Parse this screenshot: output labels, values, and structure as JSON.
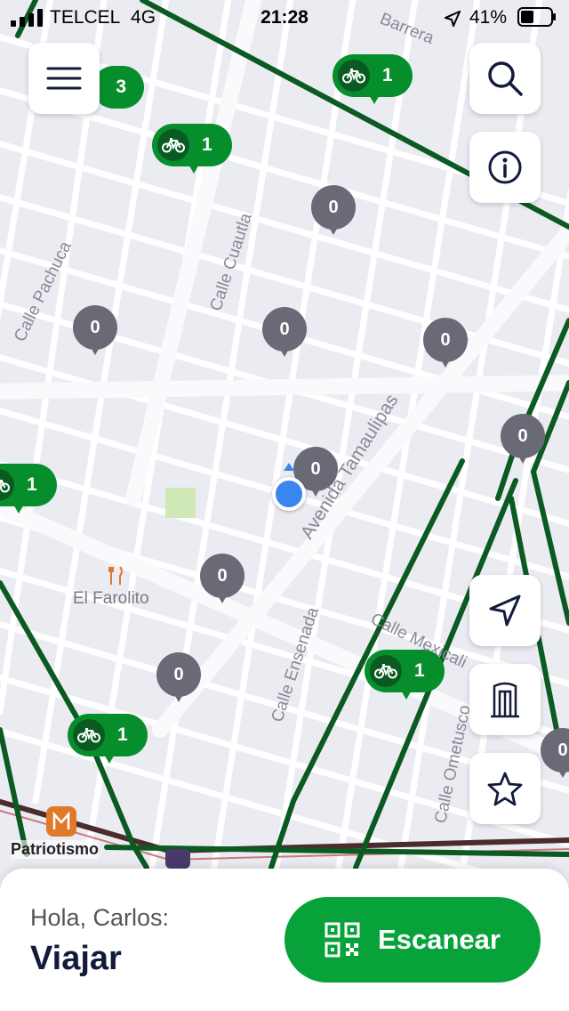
{
  "status_bar": {
    "carrier": "TELCEL",
    "network": "4G",
    "time": "21:28",
    "battery": "41%"
  },
  "map": {
    "streets": [
      "Calle Pachuca",
      "Calle Cuautla",
      "Avenida Tamaulipas",
      "Calle Ensenada",
      "Calle Mexicali",
      "Calle Ometusco",
      "Barrera"
    ],
    "places": {
      "restaurant": "El Farolito",
      "metro": "Patriotismo"
    },
    "gray_pins": [
      "0",
      "0",
      "0",
      "0",
      "0",
      "0",
      "0",
      "0",
      "0"
    ],
    "green_pins": [
      "1",
      "1",
      "1",
      "1",
      "1"
    ],
    "cluster_count": "3",
    "colors": {
      "route": "#0b5a22",
      "pin_gray": "#6a6a77",
      "pin_green": "#078e2c",
      "user_dot": "#3a86f0"
    }
  },
  "bottom_sheet": {
    "greeting": "Hola, Carlos:",
    "title": "Viajar",
    "scan_label": "Escanear"
  },
  "icons": [
    "menu-icon",
    "search-icon",
    "info-icon",
    "navigation-arrow-icon",
    "monument-icon",
    "star-icon",
    "qr-code-icon",
    "bike-icon"
  ]
}
